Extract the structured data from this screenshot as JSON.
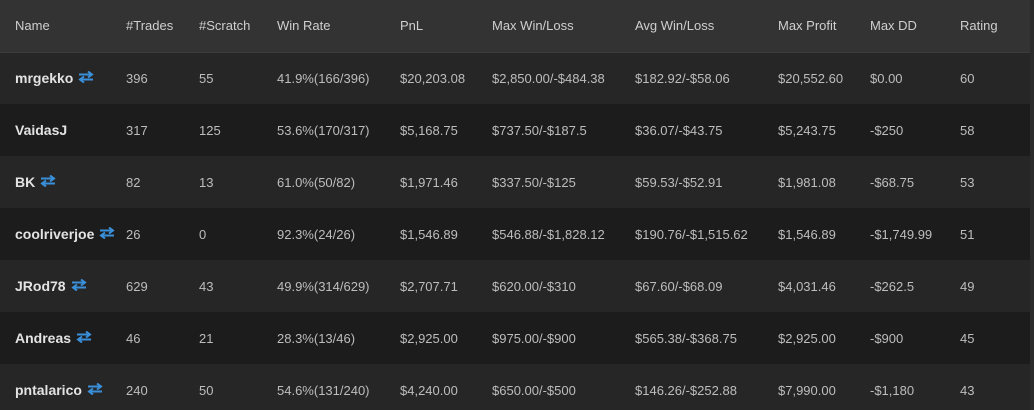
{
  "columns": [
    "Name",
    "#Trades",
    "#Scratch",
    "Win Rate",
    "PnL",
    "Max Win/Loss",
    "Avg Win/Loss",
    "Max Profit",
    "Max DD",
    "Rating"
  ],
  "accent_color": "#3a8fd9",
  "rows": [
    {
      "name": "mrgekko",
      "swap_icon": true,
      "trades": "396",
      "scratch": "55",
      "win_rate": "41.9%(166/396)",
      "pnl": "$20,203.08",
      "max_win_loss": "$2,850.00/-$484.38",
      "avg_win_loss": "$182.92/-$58.06",
      "max_profit": "$20,552.60",
      "max_dd": "$0.00",
      "rating": "60"
    },
    {
      "name": "VaidasJ",
      "swap_icon": false,
      "trades": "317",
      "scratch": "125",
      "win_rate": "53.6%(170/317)",
      "pnl": "$5,168.75",
      "max_win_loss": "$737.50/-$187.5",
      "avg_win_loss": "$36.07/-$43.75",
      "max_profit": "$5,243.75",
      "max_dd": "-$250",
      "rating": "58"
    },
    {
      "name": "BK",
      "swap_icon": true,
      "trades": "82",
      "scratch": "13",
      "win_rate": "61.0%(50/82)",
      "pnl": "$1,971.46",
      "max_win_loss": "$337.50/-$125",
      "avg_win_loss": "$59.53/-$52.91",
      "max_profit": "$1,981.08",
      "max_dd": "-$68.75",
      "rating": "53"
    },
    {
      "name": "coolriverjoe",
      "swap_icon": true,
      "trades": "26",
      "scratch": "0",
      "win_rate": "92.3%(24/26)",
      "pnl": "$1,546.89",
      "max_win_loss": "$546.88/-$1,828.12",
      "avg_win_loss": "$190.76/-$1,515.62",
      "max_profit": "$1,546.89",
      "max_dd": "-$1,749.99",
      "rating": "51"
    },
    {
      "name": "JRod78",
      "swap_icon": true,
      "trades": "629",
      "scratch": "43",
      "win_rate": "49.9%(314/629)",
      "pnl": "$2,707.71",
      "max_win_loss": "$620.00/-$310",
      "avg_win_loss": "$67.60/-$68.09",
      "max_profit": "$4,031.46",
      "max_dd": "-$262.5",
      "rating": "49"
    },
    {
      "name": "Andreas",
      "swap_icon": true,
      "trades": "46",
      "scratch": "21",
      "win_rate": "28.3%(13/46)",
      "pnl": "$2,925.00",
      "max_win_loss": "$975.00/-$900",
      "avg_win_loss": "$565.38/-$368.75",
      "max_profit": "$2,925.00",
      "max_dd": "-$900",
      "rating": "45"
    },
    {
      "name": "pntalarico",
      "swap_icon": true,
      "trades": "240",
      "scratch": "50",
      "win_rate": "54.6%(131/240)",
      "pnl": "$4,240.00",
      "max_win_loss": "$650.00/-$500",
      "avg_win_loss": "$146.26/-$252.88",
      "max_profit": "$7,990.00",
      "max_dd": "-$1,180",
      "rating": "43"
    }
  ]
}
